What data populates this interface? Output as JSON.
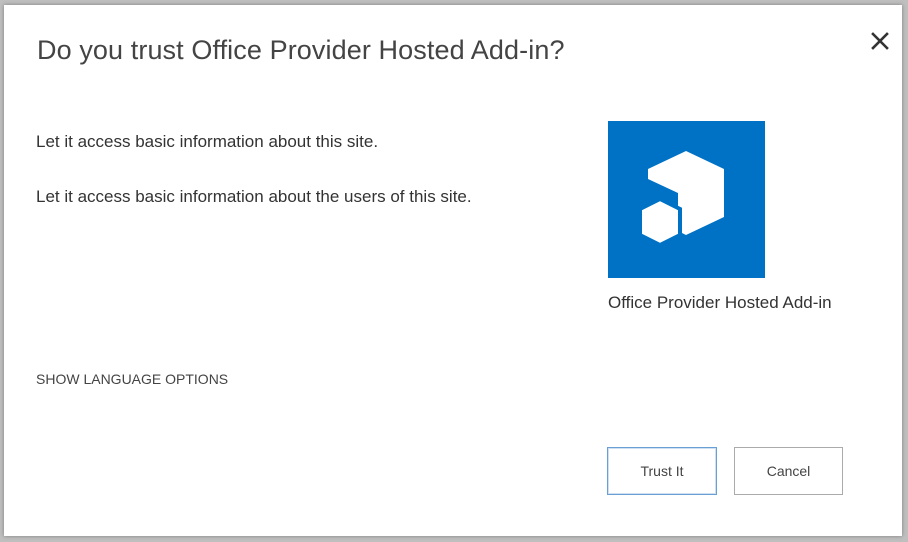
{
  "dialog": {
    "title": "Do you trust Office Provider Hosted Add-in?",
    "close_icon": "close-icon"
  },
  "permissions": [
    "Let it access basic information about this site.",
    "Let it access basic information about the users of this site."
  ],
  "app": {
    "name": "Office Provider Hosted Add-in",
    "icon": "add-in-cube-icon",
    "tile_color": "#0072c6"
  },
  "language_link": "SHOW LANGUAGE OPTIONS",
  "buttons": {
    "trust": "Trust It",
    "cancel": "Cancel"
  },
  "colors": {
    "accent": "#0072c6",
    "focus_border": "#6a9fd4",
    "text": "#444444"
  }
}
